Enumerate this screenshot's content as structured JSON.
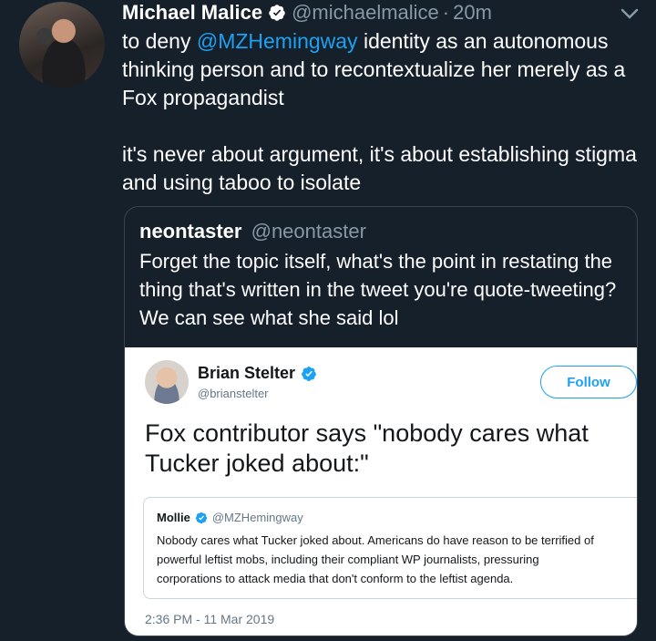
{
  "tweet": {
    "author_name": "Michael Malice",
    "author_handle": "@michaelmalice",
    "separator": "·",
    "time": "20m",
    "text_pre": "to deny ",
    "mention": "@MZHemingway",
    "text_post": " identity as an autonomous thinking person and to recontextualize her merely as a Fox propagandist",
    "text_2": "it's never about argument, it's about establishing stigma and using taboo to isolate"
  },
  "quote": {
    "author_name": "neontaster",
    "author_handle": "@neontaster",
    "text": "Forget the topic itself, what's the point in restating the thing that's written in the tweet you're quote-tweeting? We can see what she said lol"
  },
  "embedded": {
    "author_name": "Brian Stelter",
    "author_handle": "@brianstelter",
    "follow_label": "Follow",
    "text": "Fox contributor says \"nobody cares what Tucker joked about:\"",
    "inner": {
      "author_name": "Mollie",
      "author_handle": "@MZHemingway",
      "text": "Nobody cares what Tucker joked about. Americans do have reason to be terrified of\npowerful leftist mobs, including their compliant WP journalists, pressuring\ncorporations to attack media that don't conform to the leftist agenda."
    },
    "timestamp": "2:36 PM - 11 Mar 2019"
  },
  "colors": {
    "background": "#15202b",
    "accent": "#1da1f2",
    "muted": "#8899a6",
    "border": "#38444d"
  },
  "icons": [
    "avatar",
    "verified-badge-icon",
    "chevron-down-icon"
  ]
}
